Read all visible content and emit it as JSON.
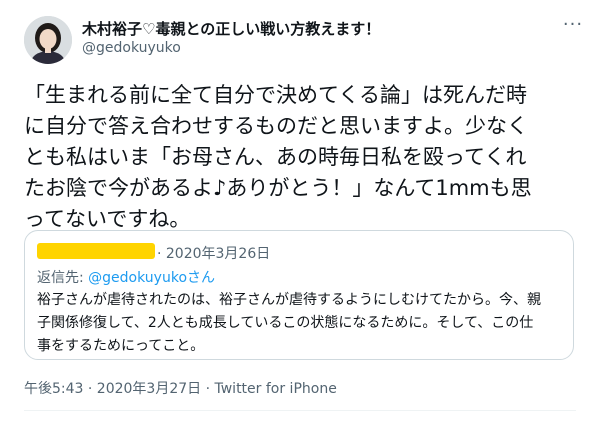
{
  "author": {
    "display_name": "木村裕子♡毒親との正しい戦い方教えます！",
    "username": "@gedokuyuko"
  },
  "icons": {
    "avatar": "profile-photo",
    "more": "more-icon"
  },
  "tweet": {
    "lines": [
      "「生まれる前に全て自分で決めてくる論」は死んだ時",
      "に自分で答え合わせするものだと思いますよ。少なく",
      "とも私はいま「お母さん、あの時毎日私を殴ってくれ",
      "たお陰で今があるよ♪ありがとう！」なんて1mmも思",
      "ってないですね。"
    ]
  },
  "quoted": {
    "date": "· 2020年3月26日",
    "reply_prefix": "返信先: ",
    "reply_handle": "@gedokuyukoさん",
    "lines": [
      "裕子さんが虐待されたのは、裕子さんが虐待するようにしむけてたから。今、親",
      "子関係修復して、2人とも成長しているこの状態になるために。そして、この仕",
      "事をするためにってこと。"
    ]
  },
  "meta": {
    "text": "午後5:43 · 2020年3月27日 · Twitter for iPhone"
  },
  "colors": {
    "text": "#0f1419",
    "secondary": "#536471",
    "link": "#1d9bf0",
    "border": "#cfd9de",
    "redaction": "#ffd400"
  }
}
